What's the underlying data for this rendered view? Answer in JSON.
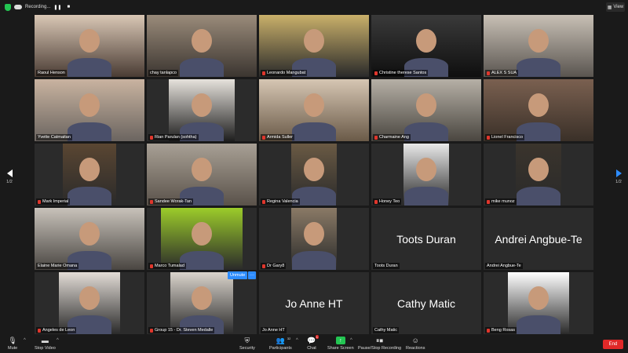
{
  "topbar": {
    "recording_label": "Recording...",
    "pause_symbol": "❚❚",
    "stop_symbol": "■",
    "view_label": "View"
  },
  "pager": {
    "left": "1/2",
    "right": "1/2"
  },
  "participants": [
    {
      "name": "Raoul Henson",
      "muted": false,
      "active": true
    },
    {
      "name": "chay tanlapco",
      "muted": false
    },
    {
      "name": "Leonardo Mangubat",
      "muted": true
    },
    {
      "name": "Christine therese Santos",
      "muted": true
    },
    {
      "name": "ALEX S SUA",
      "muted": true
    },
    {
      "name": "Yvette Catmaitan",
      "muted": false
    },
    {
      "name": "Rian Parulan (sohtha)",
      "muted": true
    },
    {
      "name": "Armida Suller",
      "muted": true
    },
    {
      "name": "Charmaine Ang",
      "muted": true
    },
    {
      "name": "Lionel Francisco",
      "muted": true
    },
    {
      "name": "Mark Imperial",
      "muted": true
    },
    {
      "name": "Sandee Worak-Tan",
      "muted": true
    },
    {
      "name": "Regina Valencia",
      "muted": true
    },
    {
      "name": "Honey Teo",
      "muted": true
    },
    {
      "name": "mike munoz",
      "muted": true
    },
    {
      "name": "Elaine Marie Omana",
      "muted": false
    },
    {
      "name": "Marco Tumalad",
      "muted": true
    },
    {
      "name": "Dr Gary8",
      "muted": true
    },
    {
      "name": "Toots Duran",
      "muted": false
    },
    {
      "name": "Andrei Angbue-Te",
      "muted": false
    },
    {
      "name": "Angeles de Leon",
      "muted": true
    },
    {
      "name": "Group 15 - Dr. Steven Medalle",
      "muted": true
    },
    {
      "name": "Jo Anne HT",
      "muted": false
    },
    {
      "name": "Cathy Matic",
      "muted": false
    },
    {
      "name": "Beng Rosas",
      "muted": true
    }
  ],
  "tile_overlay": {
    "unmute_label": "Unmute",
    "more_label": "···"
  },
  "toolbar": {
    "mute_label": "Mute",
    "stop_video_label": "Stop Video",
    "security_label": "Security",
    "participants_label": "Participants",
    "participants_count": "32",
    "chat_label": "Chat",
    "chat_badge": "1",
    "share_label": "Share Screen",
    "record_label": "Pause/Stop Recording",
    "reactions_label": "Reactions",
    "end_label": "End"
  },
  "colors": {
    "active_speaker": "#f3e46a",
    "accent_blue": "#2d8cff",
    "share_green": "#23c552",
    "end_red": "#e02828"
  }
}
